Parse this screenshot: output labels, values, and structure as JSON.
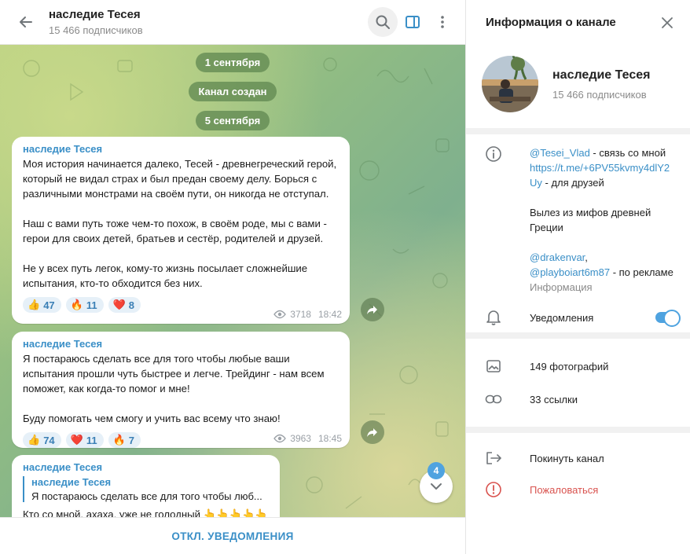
{
  "chat": {
    "title": "наследие Тесея",
    "subtitle": "15 466 подписчиков",
    "date_1": "1 сентября",
    "created": "Канал создан",
    "date_2": "5 сентября",
    "messages": [
      {
        "author": "наследие Тесея",
        "text": "Моя история начинается далеко, Тесей - древнегреческий герой, который не видал страх и был предан своему делу. Борься с различными монстрами на своём пути, он никогда не отступал.\n\nНаш с вами путь тоже чем-то похож, в своём роде, мы с вами - герои для своих детей, братьев и сестёр, родителей и друзей.\n\nНе у всех путь легок, кому-то жизнь посылает сложнейшие испытания, кто-то обходится без них.",
        "reactions": [
          {
            "emoji": "👍",
            "count": "47"
          },
          {
            "emoji": "🔥",
            "count": "11"
          },
          {
            "emoji": "❤️",
            "count": "8"
          }
        ],
        "views": "3718",
        "time": "18:42"
      },
      {
        "author": "наследие Тесея",
        "text": "Я постараюсь сделать все для того чтобы любые ваши испытания прошли чуть быстрее и легче. Трейдинг - нам всем поможет, как когда-то помог и мне!\n\nБуду помогать чем смогу и учить вас всему что знаю!",
        "reactions": [
          {
            "emoji": "👍",
            "count": "74"
          },
          {
            "emoji": "❤️",
            "count": "11"
          },
          {
            "emoji": "🔥",
            "count": "7"
          }
        ],
        "views": "3963",
        "time": "18:45"
      },
      {
        "author": "наследие Тесея",
        "quote_author": "наследие Тесея",
        "quote_text": "Я постараюсь сделать все для того чтобы люб...",
        "partial_text": "Кто со мной, ахаха, уже не голодный 👆👆👆👆👆"
      }
    ],
    "unread_count": "4",
    "mute_label": "ОТКЛ. УВЕДОМЛЕНИЯ"
  },
  "info": {
    "header_title": "Информация о канале",
    "name": "наследие Тесея",
    "subscribers": "15 466 подписчиков",
    "desc": {
      "handle": "@Tesei_Vlad",
      "handle_suffix": " - связь со мной",
      "invite_link": "https://t.me/+6PV55kvmy4dlY2Uy",
      "invite_suffix": " - для друзей",
      "tagline": "Вылез из мифов древней Греции",
      "ad_1": "@drakenvar",
      "ad_2": "@playboiart6m87",
      "ad_suffix": " - по рекламе",
      "caption": "Информация"
    },
    "notifications_label": "Уведомления",
    "notifications_on": true,
    "photos_label": "149 фотографий",
    "links_label": "33 ссылки",
    "leave_label": "Покинуть канал",
    "report_label": "Пожаловаться"
  },
  "colors": {
    "accent": "#3a8fc7",
    "danger": "#d9534f",
    "toggle": "#4fa3e0"
  }
}
